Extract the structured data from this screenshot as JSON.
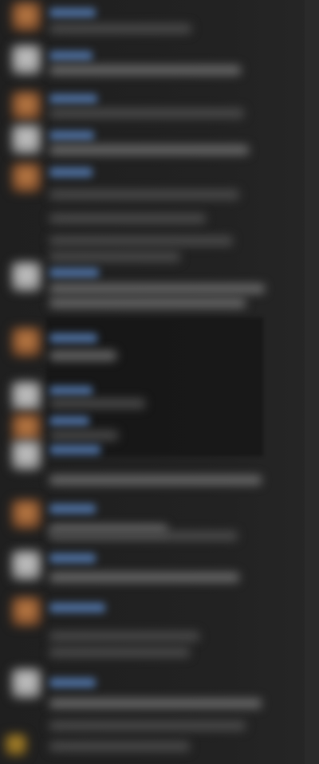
{
  "app": {
    "theme": "dark"
  },
  "messages": [
    {
      "avatar_color": "#b97a45"
    },
    {
      "avatar_color": "#cfcfcf"
    },
    {
      "avatar_color": "#b97a45"
    },
    {
      "avatar_color": "#cfcfcf"
    },
    {
      "avatar_color": "#b97a45"
    },
    {
      "avatar_color": "#cfcfcf"
    },
    {
      "avatar_color": "#b97a45"
    },
    {
      "avatar_color": "#cfcfcf"
    },
    {
      "avatar_color": "#b97a45"
    },
    {
      "avatar_color": "#cfcfcf"
    },
    {
      "avatar_color": "#b97a45"
    },
    {
      "avatar_color": "#cfcfcf"
    },
    {
      "avatar_color": "#b97a45"
    },
    {
      "avatar_color": "#cfcfcf"
    },
    {
      "avatar_color": "#b58f31"
    }
  ]
}
